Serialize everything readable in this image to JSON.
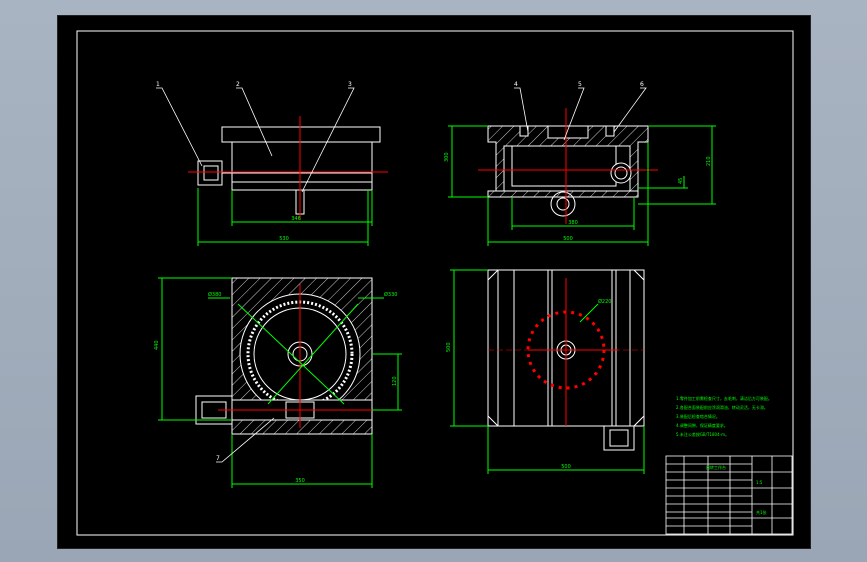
{
  "colors": {
    "background": "#000000",
    "frame": "#ffffff",
    "dimension": "#00ff00",
    "centerline": "#ff0000",
    "hatch": "#ffffff",
    "outline": "#ffffff"
  },
  "leaders": {
    "front_view": [
      "1",
      "2",
      "3"
    ],
    "side_view": [
      "4",
      "5",
      "6"
    ],
    "top_view": [
      "7"
    ]
  },
  "dimensions": {
    "front_width": "346",
    "front_overall": "530",
    "side_height": "300",
    "side_right": "210",
    "side_small": "45",
    "side_width": "380",
    "side_overall": "500",
    "top_height": "440",
    "top_width": "350",
    "top_right": "120",
    "top_circle_a": "Ø380",
    "top_circle_b": "Ø330",
    "right_height": "500",
    "right_width": "500",
    "right_label": "Ø220"
  },
  "notes": [
    "1.零件加工前需检查尺寸，去毛刺，清洁后方可装配。",
    "2.各配合面装配前应涂润滑油，转动灵活，无卡滞。",
    "3.装配后检查啮合情况。",
    "4.调整间隙，保证精度要求。",
    "5.未注公差按GB/T1804-m。"
  ],
  "title_block": {
    "name": "回转工作台",
    "scale": "1:5",
    "sheet": "共1张"
  }
}
